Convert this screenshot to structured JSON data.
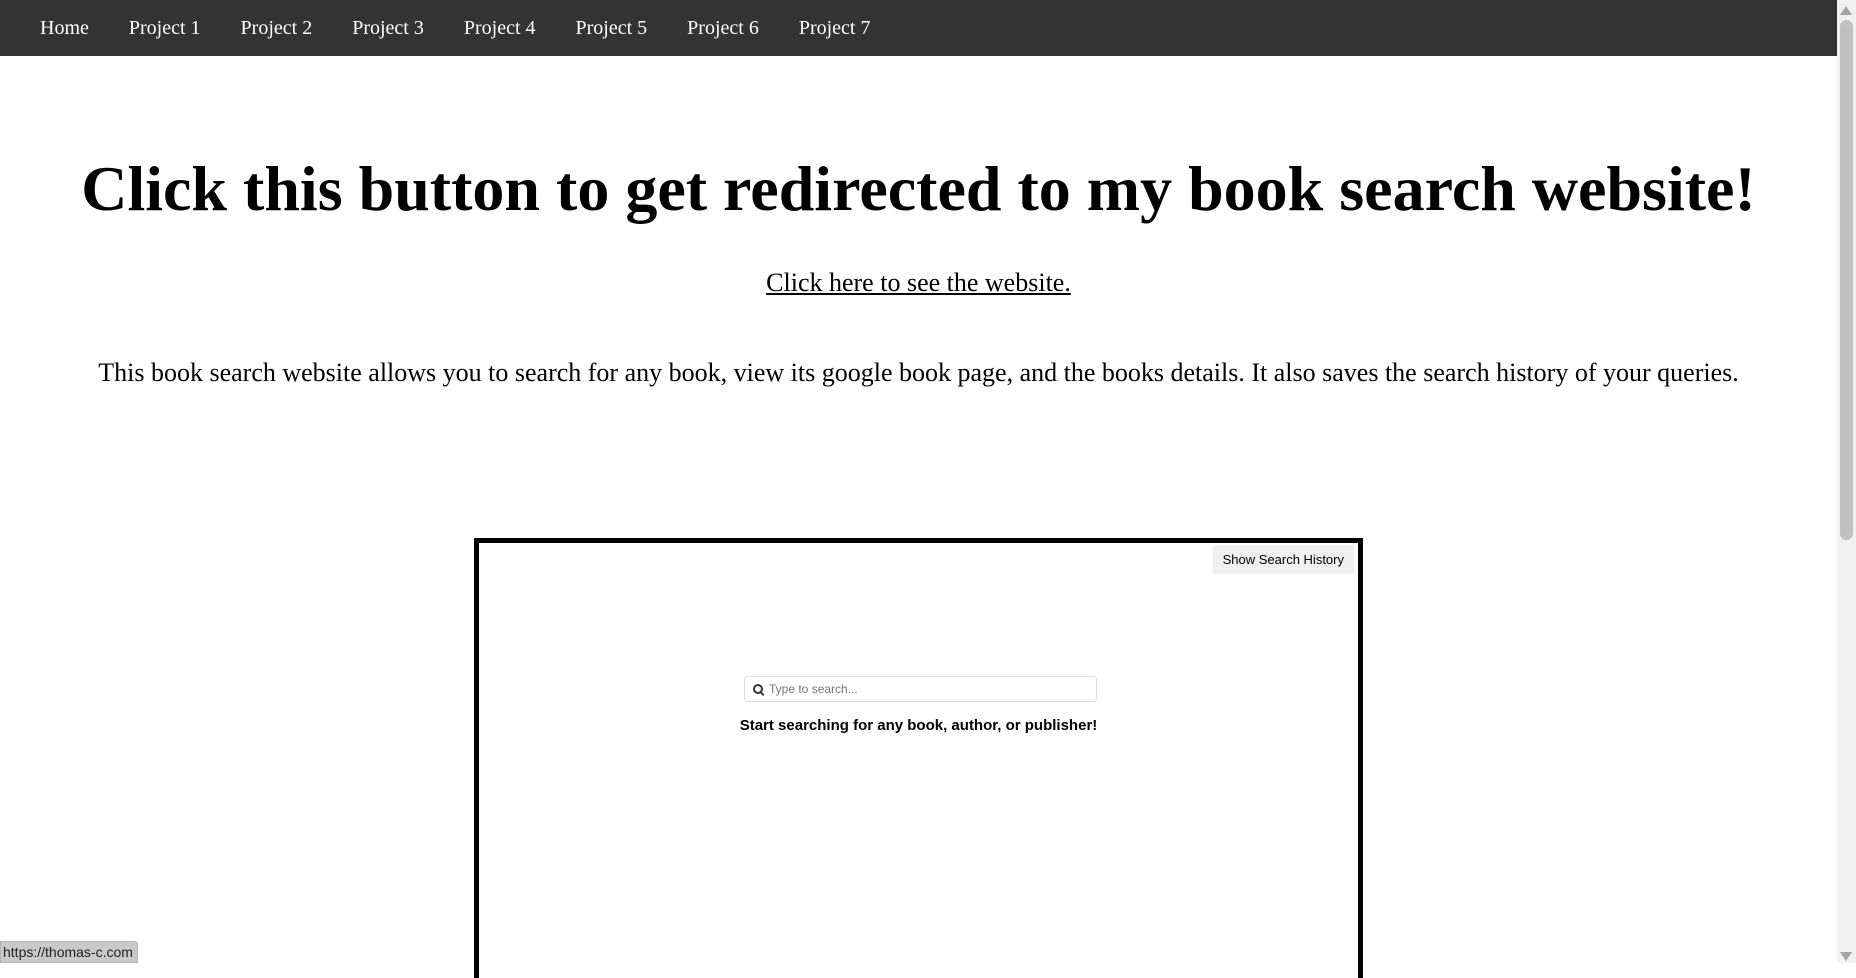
{
  "nav": {
    "items": [
      {
        "label": "Home"
      },
      {
        "label": "Project 1"
      },
      {
        "label": "Project 2"
      },
      {
        "label": "Project 3"
      },
      {
        "label": "Project 4"
      },
      {
        "label": "Project 5"
      },
      {
        "label": "Project 6"
      },
      {
        "label": "Project 7"
      }
    ]
  },
  "main": {
    "heading": "Click this button to get redirected to my book search website!",
    "link_text": "Click here to see the website.",
    "description": "This book search website allows you to search for any book, view its google book page, and the books details. It also saves the search history of your queries."
  },
  "preview": {
    "history_button": "Show Search History",
    "search_placeholder": "Type to search...",
    "search_icon": "search-icon",
    "prompt": "Start searching for any book, author, or publisher!"
  },
  "status_bar": {
    "url": "https://thomas-c.com"
  },
  "colors": {
    "navbar_bg": "#333333",
    "nav_text": "#ffffff",
    "page_bg": "#ffffff"
  }
}
